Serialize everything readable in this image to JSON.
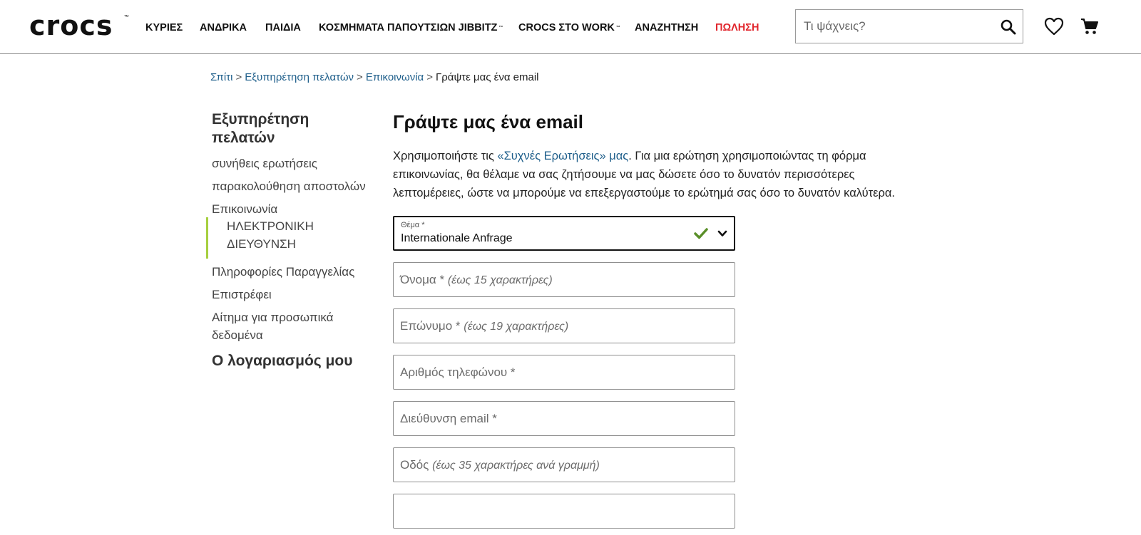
{
  "brand": {
    "logo": "crocs",
    "tm": "™"
  },
  "nav": {
    "items": [
      {
        "label": "ΚΥΡΙΕΣ"
      },
      {
        "label": "ΑΝΔΡΙΚΑ"
      },
      {
        "label": "ΠΑΙΔΙΑ"
      },
      {
        "label": "ΚΟΣΜΗΜΑΤΑ ΠΑΠΟΥΤΣΙΩΝ JIBBITZ",
        "tm": "™"
      },
      {
        "label": "CROCS ΣΤΟ WORK",
        "tm": "™"
      },
      {
        "label": "ΑΝΑΖΗΤΗΣΗ"
      },
      {
        "label": "ΠΩΛΗΣΗ"
      }
    ],
    "sale_color": "#e1262d"
  },
  "search": {
    "placeholder": "Τι ψάχνεις?",
    "icon": "search-icon"
  },
  "header_icons": {
    "wishlist": "heart-icon",
    "cart": "cart-icon"
  },
  "breadcrumb": {
    "items": [
      "Σπίτι",
      "Εξυπηρέτηση πελατών",
      "Επικοινωνία"
    ],
    "current": "Γράψτε μας ένα email",
    "separator": ">"
  },
  "sidebar": {
    "title_line1": "Εξυπηρέτηση",
    "title_line2": "πελατών",
    "links": [
      "συνήθεις ερωτήσεις",
      "παρακολούθηση αποστολών",
      "Επικοινωνία"
    ],
    "active_sub_line1": "ΗΛΕΚΤΡΟΝΙΚΗ",
    "active_sub_line2": "ΔΙΕΥΘΥΝΣΗ",
    "links_after": [
      "Πληροφορίες Παραγγελίας",
      "Επιστρέφει"
    ],
    "privacy_line1": "Αίτημα για προσωπικά",
    "privacy_line2": "δεδομένα",
    "account": "Ο λογαριασμός μου",
    "active_accent": "#a6cf3f"
  },
  "main": {
    "title": "Γράψτε μας ένα email",
    "intro_before": "Χρησιμοποιήστε τις ",
    "intro_link": "«Συχνές Ερωτήσεις» μας",
    "intro_after": ". Για μια ερώτηση χρησιμοποιώντας τη φόρμα επικοινωνίας, θα θέλαμε να σας ζητήσουμε να μας δώσετε όσο το δυνατόν περισσότερες λεπτομέρειες, ώστε να μπορούμε να επεξεργαστούμε το ερώτημά σας όσο το δυνατόν καλύτερα.",
    "link_color": "#1f5f8b"
  },
  "form": {
    "subject": {
      "label": "Θέμα *",
      "value": "Internationale Anfrage",
      "valid_color": "#5a8f29"
    },
    "fields": [
      {
        "label": "Όνομα *",
        "hint": "(έως 15 χαρακτήρες)"
      },
      {
        "label": "Επώνυμο *",
        "hint": "(έως 19 χαρακτήρες)"
      },
      {
        "label": "Αριθμός τηλεφώνου *",
        "hint": ""
      },
      {
        "label": "Διεύθυνση email *",
        "hint": ""
      },
      {
        "label": "Οδός",
        "hint": "(έως 35 χαρακτήρες ανά γραμμή)"
      },
      {
        "label": "",
        "hint": ""
      }
    ]
  }
}
